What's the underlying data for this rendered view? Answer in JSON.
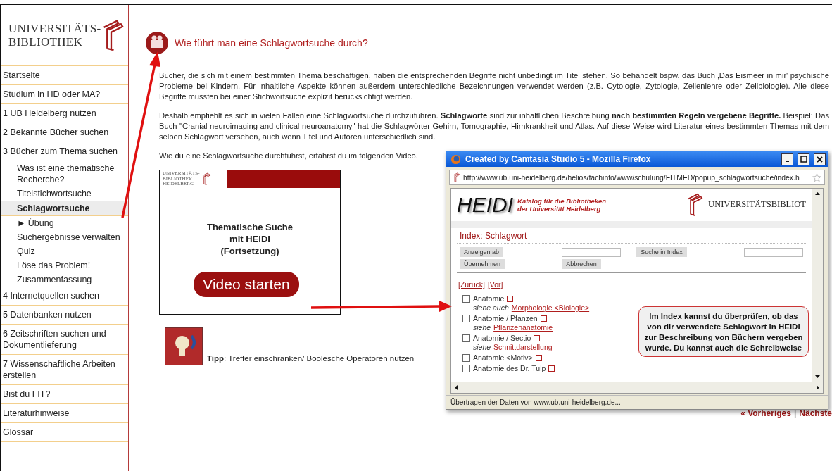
{
  "logo": {
    "lines": [
      "UNIVERSITÄTS-",
      "BIBLIOTHEK"
    ]
  },
  "sidebar": {
    "items": [
      {
        "label": "Startseite",
        "selected": false
      },
      {
        "label": "Studium in HD oder MA?",
        "selected": false
      },
      {
        "label": "1 UB Heidelberg nutzen",
        "selected": false
      },
      {
        "label": "2 Bekannte Bücher suchen",
        "selected": false
      },
      {
        "label": "3 Bücher zum Thema suchen",
        "selected": false,
        "children": [
          {
            "label": "Was ist eine thematische Recherche?",
            "selected": false
          },
          {
            "label": "Titelstichwortsuche",
            "selected": false
          },
          {
            "label": "Schlagwortsuche",
            "selected": true
          },
          {
            "label": "► Übung",
            "selected": false
          },
          {
            "label": "Suchergebnisse verwalten",
            "selected": false
          },
          {
            "label": "Quiz",
            "selected": false
          },
          {
            "label": "Löse das Problem!",
            "selected": false
          },
          {
            "label": "Zusammenfassung",
            "selected": false
          }
        ]
      },
      {
        "label": "4 Internetquellen suchen",
        "selected": false
      },
      {
        "label": "5 Datenbanken nutzen",
        "selected": false
      },
      {
        "label": "6 Zeitschriften suchen und Dokumentlieferung",
        "selected": false
      },
      {
        "label": "7 Wissenschaftliche Arbeiten erstellen",
        "selected": false
      },
      {
        "label": "Bist du FIT?",
        "selected": false
      },
      {
        "label": "Literaturhinweise",
        "selected": false
      },
      {
        "label": "Glossar",
        "selected": false
      }
    ]
  },
  "content": {
    "title": "Wie führt man eine Schlagwortsuche durch?",
    "paragraphs": [
      "Bücher, die sich mit einem bestimmten Thema beschäftigen, haben die entsprechenden Begriffe nicht unbedingt im Titel stehen. So behandelt bspw. das Buch ‚Das Eismeer in mir' psychische Probleme bei Kindern. Für inhaltliche Aspekte können außerdem unterschiedliche Bezeichnungen verwendet werden (z.B. Cytologie, Zytologie, Zellenlehre oder Zellbiologie). Alle diese Begriffe müssten bei einer Stichwortsuche explizit berücksichtigt werden.",
      "Deshalb empfiehlt es sich in vielen Fällen eine Schlagwortsuche durchzuführen. **Schlagworte** sind zur inhaltlichen Beschreibung **nach bestimmten Regeln vergebene Begriffe.** Beispiel: Das Buch \"Cranial neuroimaging and clinical neuroanatomy\" hat die Schlagwörter Gehirn, Tomographie, Hirnkrankheit und Atlas. Auf diese Weise wird Literatur eines bestimmten Themas mit dem selben Schlagwort versehen, auch wenn Titel und Autoren unterschiedlich sind.",
      "Wie du eine Schlagwortsuche durchführst, erfährst du im folgenden Video."
    ],
    "video": {
      "logo_lines": [
        "UNIVERSITÄTS-",
        "BIBLIOTHEK",
        "HEIDELBERG"
      ],
      "title_lines": [
        "Thematische Suche",
        "mit HEIDI",
        "(Fortsetzung)"
      ],
      "button": "Video starten"
    },
    "tip": "**Tipp**: Treffer einschränken/ Boolesche Operatoren nutzen",
    "pager": {
      "previous": "« Vorheriges",
      "separator": "|",
      "next": "Nächste"
    }
  },
  "popup": {
    "title": "Created by Camtasia Studio 5 - Mozilla Firefox",
    "url": "http://www.ub.uni-heidelberg.de/helios/fachinfo/www/schulung/FITMED/popup_schlagwortsuche/index.h",
    "heidi": {
      "name": "HEIDI",
      "tagline": [
        "Katalog für die Bibliotheken",
        "der Universität Heidelberg"
      ],
      "library": "UNIVERSITÄTSBIBLIOT"
    },
    "heading": "Index: Schlagwort",
    "buttons": [
      "Anzeigen ab",
      "Suche in Index",
      "Übernehmen",
      "Abbrechen"
    ],
    "links": [
      "[Zurück]",
      "[Vor]"
    ],
    "entries": [
      {
        "term": "Anatomie",
        "checked": false,
        "ref_label": "siehe auch",
        "ref": "Morphologie <Biologie>"
      },
      {
        "term": "Anatomie / Pfanzen",
        "checked": false,
        "ref_label": "siehe",
        "ref": "Pflanzenanatomie"
      },
      {
        "term": "Anatomie / Sectio",
        "checked": false,
        "ref_label": "siehe",
        "ref": "Schnittdarstellung"
      },
      {
        "term": "Anatomie <Motiv>",
        "checked": false
      },
      {
        "term": "Anatomie des Dr. Tulp",
        "checked": false
      }
    ],
    "callout": "Im Index kannst du überprüfen, ob das von dir verwendete Schlagwort in HEIDI zur Beschreibung von Büchern vergeben wurde. Du kannst auch die Schreibweise",
    "status": "Übertragen der Daten von www.ub.uni-heidelberg.de..."
  }
}
